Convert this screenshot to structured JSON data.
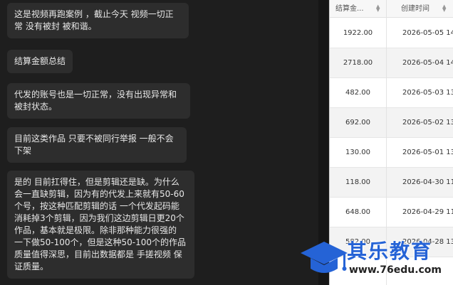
{
  "chat": {
    "messages": [
      {
        "text": "这是视频再跑案例 ，截止今天 视频一切正常 没有被封 被和谐。"
      },
      {
        "text": "结算金额总结"
      },
      {
        "text": "代发的账号也是一切正常，没有出现异常和被封状态。"
      },
      {
        "text": "目前这类作品 只要不被同行举报  一般不会下架"
      },
      {
        "text": "是的 目前扛得住，但是剪辑还是缺。为什么会一直缺剪辑，因为有的代发上来就有50-60个号，按这种匹配剪辑的话 一个代发起码能消耗掉3个剪辑，因为我们这边剪辑日更20个作品，基本就是极限。除非那种能力很强的 一下做50-100个，但是这种50-100个的作品 质量值得深思，目前出数据都是 手搓视频 保证质量。"
      }
    ]
  },
  "table": {
    "headers": {
      "amount": "结算金...",
      "created": "创建时间"
    },
    "rows": [
      {
        "amount": "1922.00",
        "created": "2026-05-05 14:..."
      },
      {
        "amount": "2718.00",
        "created": "2026-05-04 14:..."
      },
      {
        "amount": "482.00",
        "created": "2026-05-03 13:..."
      },
      {
        "amount": "692.00",
        "created": "2026-05-02 13:..."
      },
      {
        "amount": "130.00",
        "created": "2026-05-01 13:..."
      },
      {
        "amount": "118.00",
        "created": "2026-04-30 11:..."
      },
      {
        "amount": "648.00",
        "created": "2026-04-29 11:..."
      },
      {
        "amount": "582.00",
        "created": "2026-04-28 13:..."
      }
    ]
  },
  "watermark": {
    "title": "其乐教育",
    "url": "www.76edu.com",
    "icon": "graduation-cap-icon"
  },
  "colors": {
    "chat_bg": "#1e1e1e",
    "bubble_bg": "#2d2d2d",
    "watermark_blue": "#2563d6"
  }
}
